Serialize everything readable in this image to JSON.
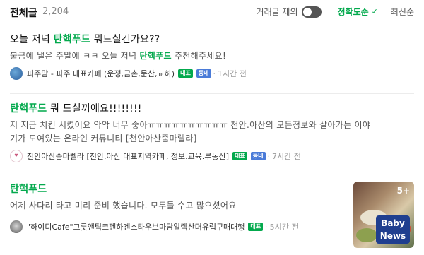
{
  "header": {
    "title": "전체글",
    "count": "2,204",
    "exclude_trade": "거래글 제외",
    "sort_accuracy": "정확도순",
    "sort_latest": "최신순"
  },
  "posts": [
    {
      "title_pre": "오늘 저녁 ",
      "title_hl": "탄핵푸드",
      "title_post": " 뭐드실건가요??",
      "desc_pre": "불금에 낼은 주말에 ㅋㅋ 오늘 저녁 ",
      "desc_hl": "탄핵푸드",
      "desc_post": " 추천해주세요!",
      "author": "파주맘 - 파주 대표카페 (운정,금촌,문산,교하)",
      "badge1": "대표",
      "badge2": "동네",
      "time": "1시간 전"
    },
    {
      "title_pre": "",
      "title_hl": "탄핵푸드",
      "title_post": " 뭐 드실꺼에요!!!!!!!!",
      "desc_line1": "저 지금 치킨 시켰어요 악악 너무 좋아ㅠㅠㅠㅠㅠㅠㅠㅠㅠㅠ 천안.아산의 모든정보와 살아가는 이야",
      "desc_line2": "기가 모여있는 온라인 커뮤니티 [천안아산줌마렐라]",
      "author": "천안아산줌마렐라 [천안.아산 대표지역카페, 정보.교육.부동산]",
      "badge1": "대표",
      "badge2": "동네",
      "time": "7시간 전"
    },
    {
      "title_hl": "탄핵푸드",
      "desc": "어제 사다리 타고 미리 준비 했습니다. 모두들 수고 많으셨어요",
      "author": "\"하이디Cafe\"그릇앤틱코펜하겐스타우브마담알렉산더유럽구매대행",
      "badge1": "대표",
      "time": "5시간 전",
      "thumb_count": "5+",
      "thumb_logo_line1": "Baby",
      "thumb_logo_line2": "News"
    }
  ],
  "colors": {
    "accent": "#03a94d",
    "badge_blue": "#4a7bd8"
  }
}
